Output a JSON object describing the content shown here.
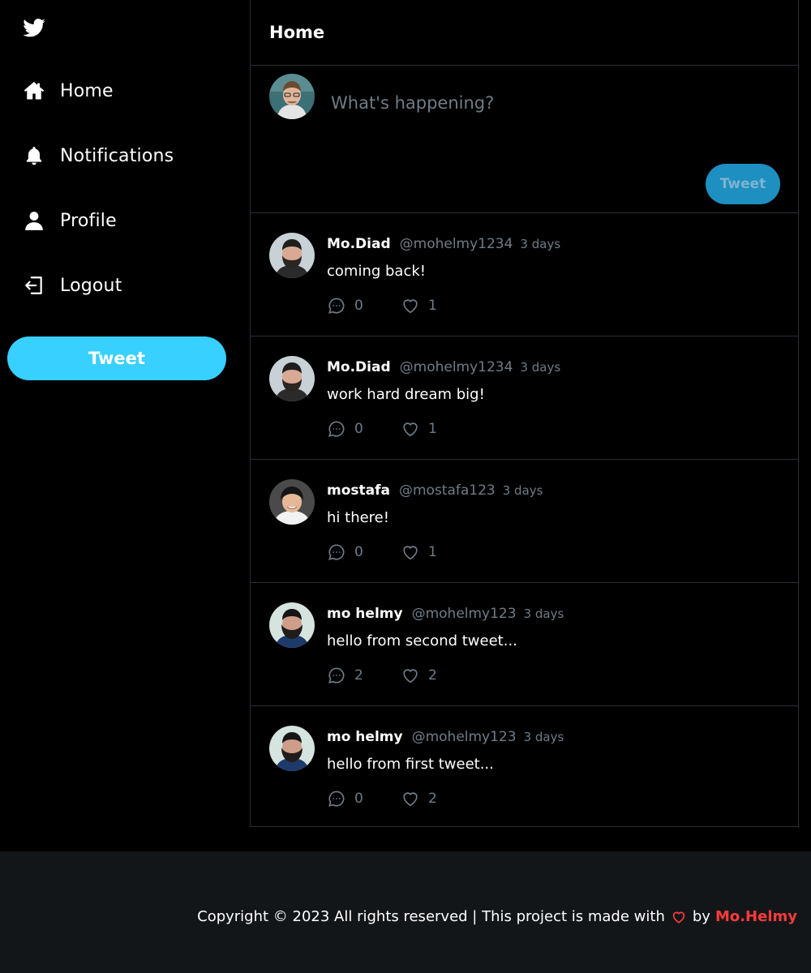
{
  "colors": {
    "accent": "#38d0ff",
    "muted": "#6f7c86",
    "author": "#ff3a3a",
    "footer_bg": "#131619"
  },
  "sidebar": {
    "logo_icon": "twitter-bird-icon",
    "items": [
      {
        "label": "Home",
        "icon": "home-icon"
      },
      {
        "label": "Notifications",
        "icon": "bell-icon"
      },
      {
        "label": "Profile",
        "icon": "user-icon"
      },
      {
        "label": "Logout",
        "icon": "logout-icon"
      }
    ],
    "tweet_button": "Tweet"
  },
  "header": {
    "title": "Home"
  },
  "composer": {
    "placeholder": "What's happening?",
    "tweet_button": "Tweet"
  },
  "tweets": [
    {
      "name": "Mo.Diad",
      "handle": "@mohelmy1234",
      "time": "3 days",
      "text": "coming back!",
      "replies": "0",
      "likes": "1"
    },
    {
      "name": "Mo.Diad",
      "handle": "@mohelmy1234",
      "time": "3 days",
      "text": "work hard dream big!",
      "replies": "0",
      "likes": "1"
    },
    {
      "name": "mostafa",
      "handle": "@mostafa123",
      "time": "3 days",
      "text": "hi there!",
      "replies": "0",
      "likes": "1"
    },
    {
      "name": "mo helmy",
      "handle": "@mohelmy123",
      "time": "3 days",
      "text": "hello from second tweet...",
      "replies": "2",
      "likes": "2"
    },
    {
      "name": "mo helmy",
      "handle": "@mohelmy123",
      "time": "3 days",
      "text": "hello from first tweet...",
      "replies": "0",
      "likes": "2"
    }
  ],
  "footer": {
    "text_before": "Copyright © 2023 All rights reserved | This project is made with",
    "heart_icon": "heart-icon",
    "by": "by",
    "author": "Mo.Helmy"
  }
}
